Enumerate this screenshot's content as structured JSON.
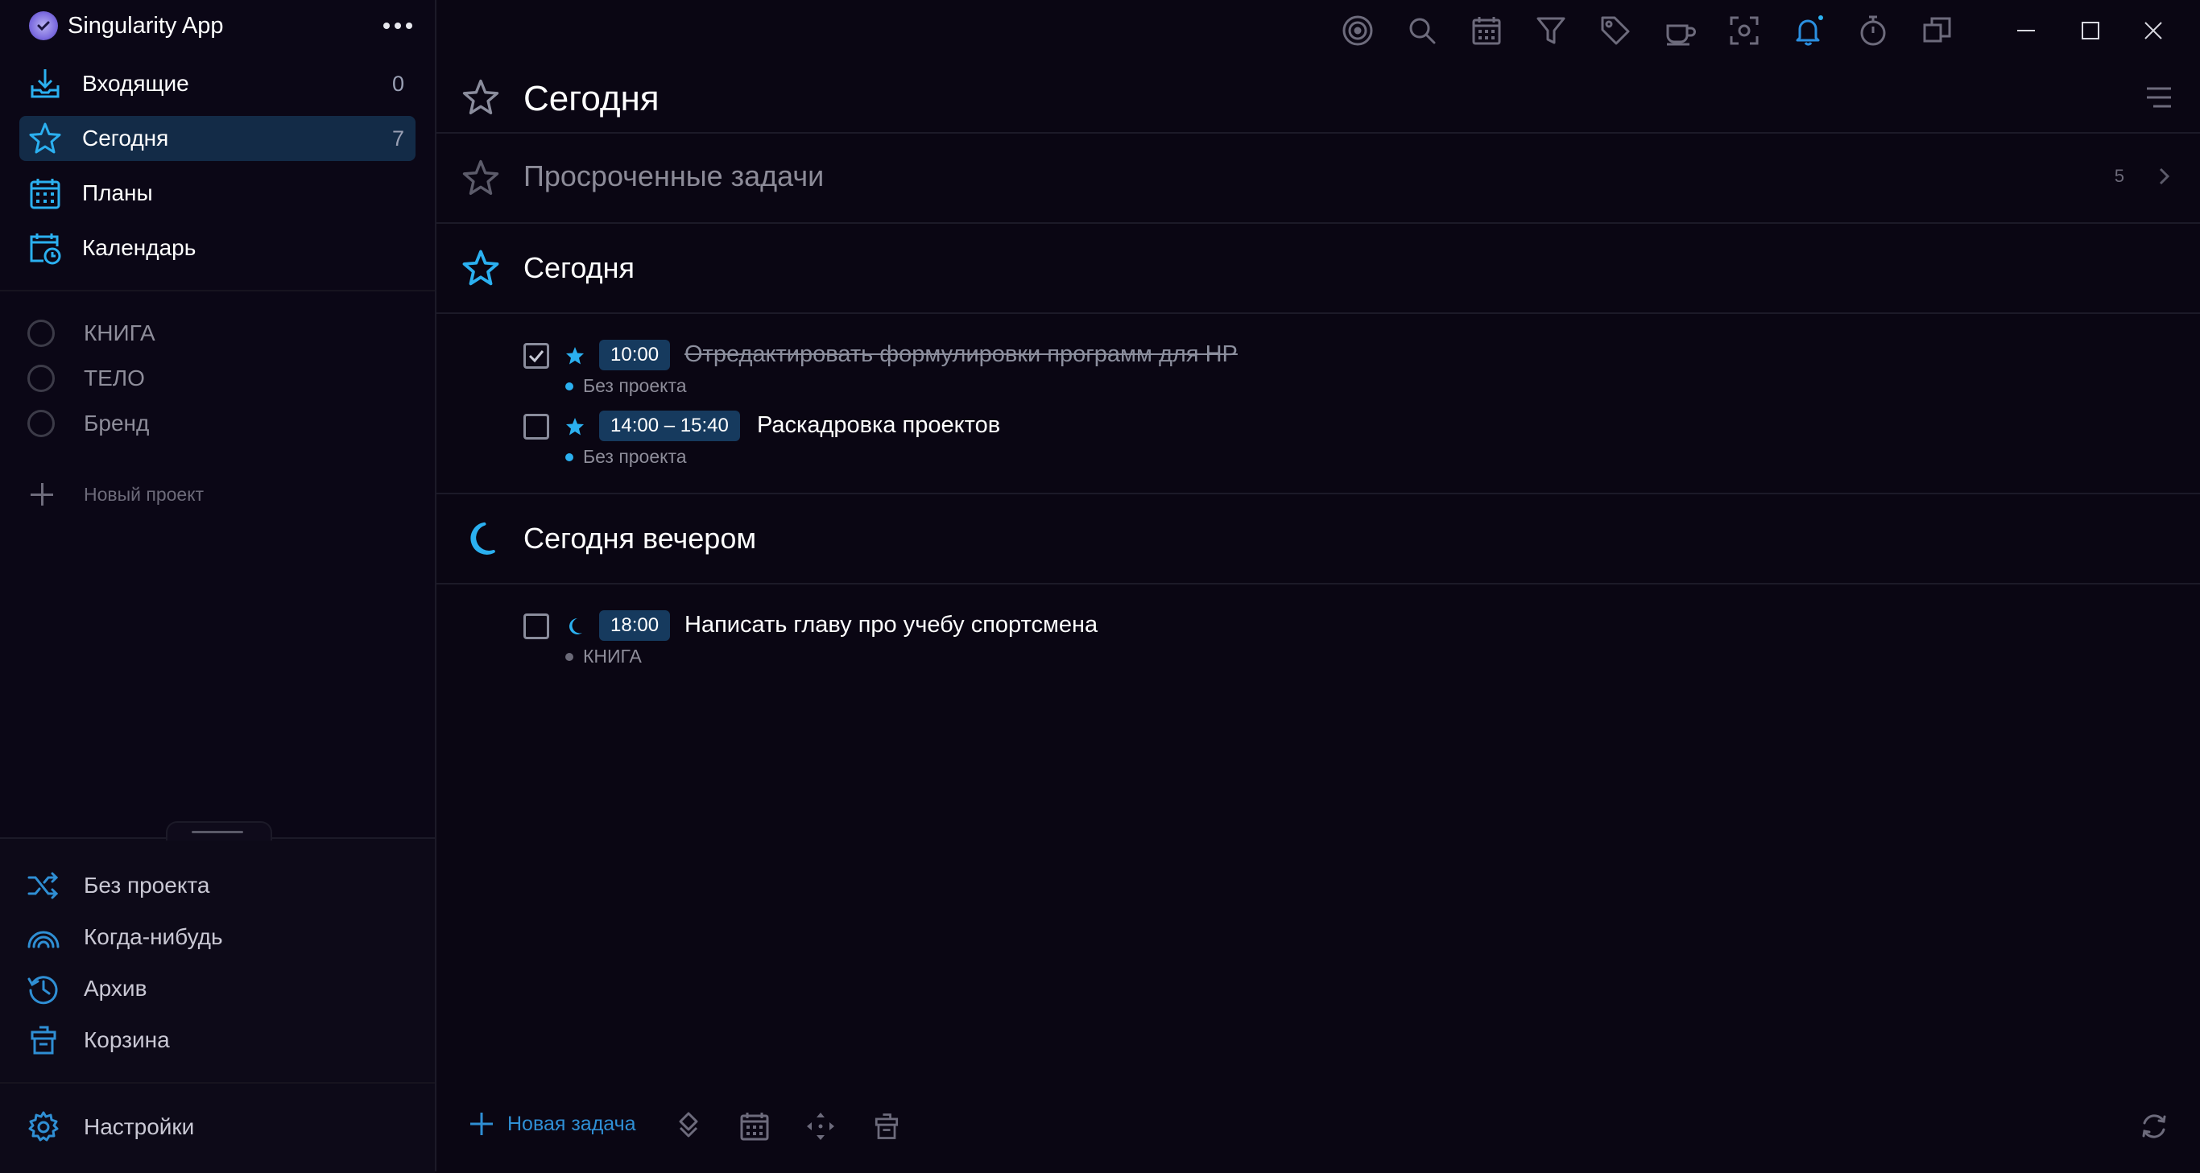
{
  "app": {
    "title": "Singularity App"
  },
  "nav": [
    {
      "label": "Входящие",
      "count": "0"
    },
    {
      "label": "Сегодня",
      "count": "7"
    },
    {
      "label": "Планы"
    },
    {
      "label": "Календарь"
    }
  ],
  "projects": [
    {
      "label": "КНИГА"
    },
    {
      "label": "ТЕЛО"
    },
    {
      "label": "Бренд"
    }
  ],
  "new_project": "Новый проект",
  "bottom_nav": [
    {
      "label": "Без проекта"
    },
    {
      "label": "Когда-нибудь"
    },
    {
      "label": "Архив"
    },
    {
      "label": "Корзина"
    }
  ],
  "settings": "Настройки",
  "page": {
    "title": "Сегодня"
  },
  "sections": {
    "overdue": {
      "title": "Просроченные задачи",
      "count": "5"
    },
    "today": {
      "title": "Сегодня"
    },
    "evening": {
      "title": "Сегодня вечером"
    }
  },
  "tasks": {
    "today": [
      {
        "time": "10:00",
        "title": "Отредактировать формулировки программ для HP",
        "project": "Без проекта",
        "done": true
      },
      {
        "time": "14:00 – 15:40",
        "title": "Раскадровка проектов",
        "project": "Без проекта",
        "done": false
      }
    ],
    "evening": [
      {
        "time": "18:00",
        "title": "Написать главу про учебу спортсмена",
        "project": "КНИГА",
        "done": false
      }
    ]
  },
  "bottom_bar": {
    "new_task": "Новая задача"
  },
  "colors": {
    "accent": "#2bb0f0",
    "link": "#2f8fd4",
    "badge": "#163a5e",
    "active_nav": "#132b47",
    "background": "#0a0613"
  }
}
